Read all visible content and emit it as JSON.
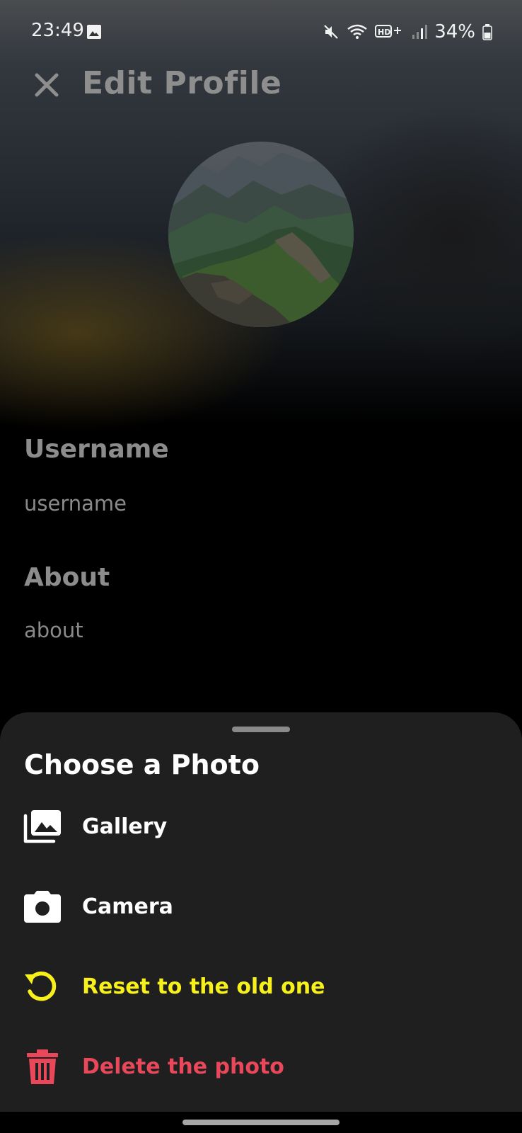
{
  "status_bar": {
    "time": "23:49",
    "battery_percent": "34%",
    "icons": [
      "image-icon",
      "mute-icon",
      "wifi-icon",
      "hd-voice-icon",
      "signal-icon",
      "battery-icon"
    ]
  },
  "app_bar": {
    "close_icon": "close-icon",
    "title": "Edit Profile"
  },
  "profile": {
    "avatar": "mountain-landscape-photo"
  },
  "fields": {
    "username": {
      "label": "Username",
      "value": "username"
    },
    "about": {
      "label": "About",
      "value": "about"
    }
  },
  "sheet": {
    "title": "Choose a Photo",
    "options": [
      {
        "label": "Gallery",
        "icon": "gallery-icon",
        "color": "#ffffff"
      },
      {
        "label": "Camera",
        "icon": "camera-icon",
        "color": "#ffffff"
      },
      {
        "label": "Reset to the old one",
        "icon": "reset-icon",
        "color": "#f7f01a"
      },
      {
        "label": "Delete the photo",
        "icon": "trash-icon",
        "color": "#e8485a"
      }
    ]
  }
}
